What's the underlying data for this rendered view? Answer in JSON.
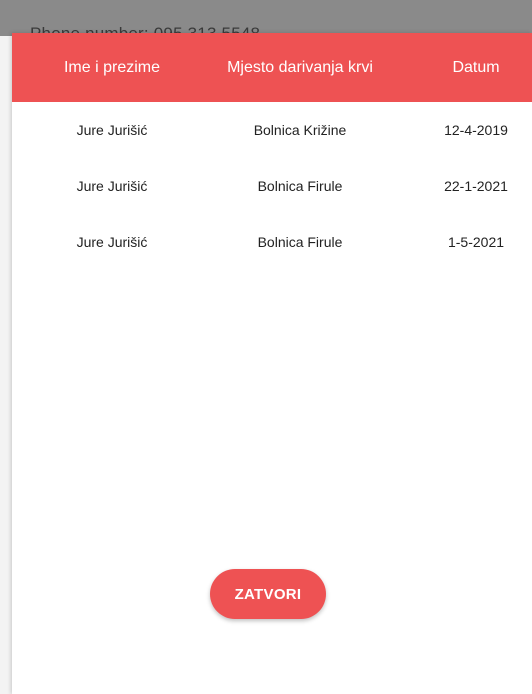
{
  "background": {
    "partial_text": "Phone number: 095 313 5548"
  },
  "table": {
    "headers": [
      "Ime i prezime",
      "Mjesto darivanja krvi",
      "Datum"
    ],
    "rows": [
      {
        "name": "Jure Jurišić",
        "place": "Bolnica Križine",
        "date": "12-4-2019"
      },
      {
        "name": "Jure Jurišić",
        "place": "Bolnica Firule",
        "date": "22-1-2021"
      },
      {
        "name": "Jure Jurišić",
        "place": "Bolnica Firule",
        "date": "1-5-2021"
      }
    ]
  },
  "close_button": {
    "label": "ZATVORI"
  },
  "colors": {
    "accent": "#ee5253",
    "dialog_bg": "#ffffff",
    "page_bg": "#f3f3f3"
  }
}
